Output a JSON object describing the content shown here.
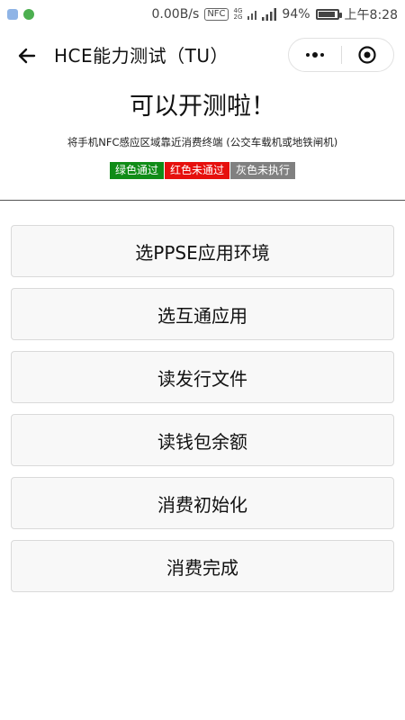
{
  "status_bar": {
    "net_speed": "0.00B/s",
    "nfc": "NFC",
    "network_4g_top": "4G",
    "network_4g_bottom": "2G",
    "battery_percent": "94%",
    "battery_level": 0.94,
    "time": "上午8:28",
    "left_icons": [
      "sim-icon",
      "nfc-app-icon"
    ]
  },
  "titlebar": {
    "title": "HCE能力测试（TU）"
  },
  "header": {
    "headline": "可以开测啦！",
    "subtext": "将手机NFC感应区域靠近消费终端 (公交车载机或地铁闸机)"
  },
  "legend": [
    {
      "label": "绿色通过",
      "color": "#108c17"
    },
    {
      "label": "红色未通过",
      "color": "#e6100d"
    },
    {
      "label": "灰色未执行",
      "color": "#808080"
    }
  ],
  "actions": [
    {
      "label": "选PPSE应用环境"
    },
    {
      "label": "选互通应用"
    },
    {
      "label": "读发行文件"
    },
    {
      "label": "读钱包余额"
    },
    {
      "label": "消费初始化"
    },
    {
      "label": "消费完成"
    }
  ]
}
